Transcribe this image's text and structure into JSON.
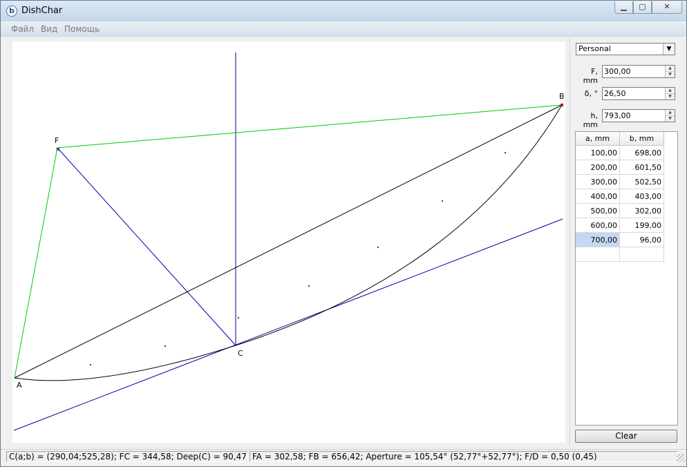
{
  "window": {
    "title": "DishChar",
    "icon": "app-logo-b",
    "icon_text": "b"
  },
  "menu": {
    "items": [
      "Файл",
      "Вид",
      "Помощь"
    ]
  },
  "panel": {
    "preset": {
      "value": "Personal"
    },
    "f": {
      "label": "F, mm",
      "value": "300,00"
    },
    "delta": {
      "label": "δ, °",
      "value": "26,50"
    },
    "h": {
      "label": "h, mm",
      "value": "793,00"
    },
    "table": {
      "headers": [
        "a, mm",
        "b, mm"
      ],
      "rows": [
        [
          "100,00",
          "698,00"
        ],
        [
          "200,00",
          "601,50"
        ],
        [
          "300,00",
          "502,50"
        ],
        [
          "400,00",
          "403,00"
        ],
        [
          "500,00",
          "302,00"
        ],
        [
          "600,00",
          "199,00"
        ],
        [
          "700,00",
          "96,00"
        ],
        [
          "",
          ""
        ]
      ],
      "selected_row": 6
    },
    "clear_label": "Clear"
  },
  "drawing": {
    "point_labels": {
      "A": "A",
      "B": "B",
      "C": "C",
      "F": "F"
    },
    "colors": {
      "focus_lines": "#00c800",
      "axis_lines": "#0000a0",
      "chord": "#000000",
      "curve": "#000000",
      "marks": "#c00000"
    }
  },
  "status": {
    "left": "C(a;b) = (290,04;525,28); FC = 344,58; Deep(C) = 90,47",
    "right": "FA = 302,58; FB = 656,42; Aperture = 105,54° (52,77°+52,77°); F/D = 0,50 (0,45)"
  }
}
